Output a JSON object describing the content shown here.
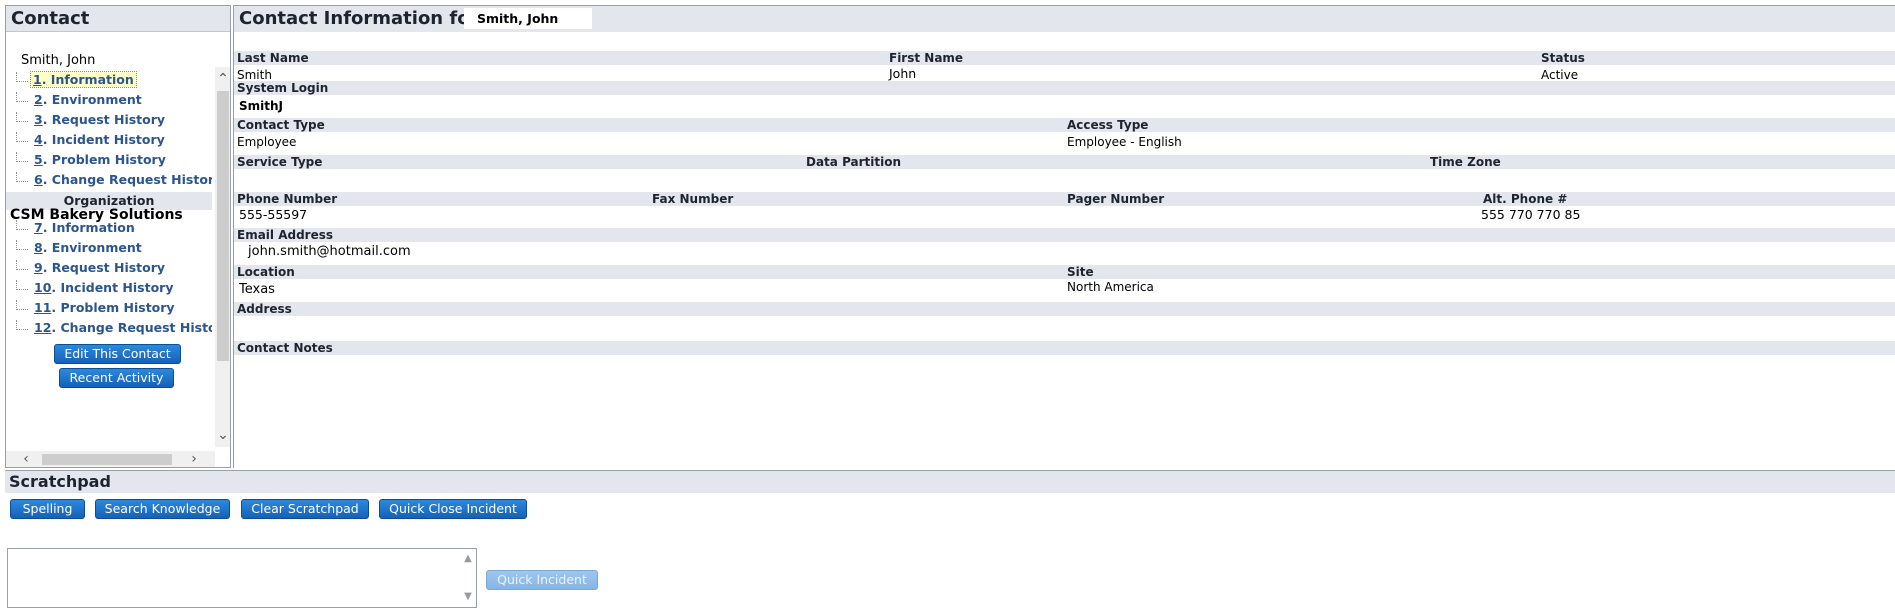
{
  "contact_panel": {
    "title": "Contact",
    "contact_name": "Smith, John",
    "contact_items": [
      {
        "num": "1",
        "label": ". Information"
      },
      {
        "num": "2",
        "label": ". Environment"
      },
      {
        "num": "3",
        "label": ". Request History"
      },
      {
        "num": "4",
        "label": ". Incident History"
      },
      {
        "num": "5",
        "label": ". Problem History"
      },
      {
        "num": "6",
        "label": ". Change Request History"
      }
    ],
    "organization_heading": "Organization",
    "organization_name": "CSM Bakery Solutions",
    "organization_items": [
      {
        "num": "7",
        "label": ". Information"
      },
      {
        "num": "8",
        "label": ". Environment"
      },
      {
        "num": "9",
        "label": ". Request History"
      },
      {
        "num": "10",
        "label": ". Incident History"
      },
      {
        "num": "11",
        "label": ". Problem History"
      },
      {
        "num": "12",
        "label": ". Change Request History"
      }
    ],
    "edit_button": "Edit This Contact",
    "recent_activity_button": "Recent Activity"
  },
  "contact_info": {
    "title": "Contact Information for",
    "title_name": "Smith, John",
    "last_name_label": "Last Name",
    "last_name": "Smith",
    "first_name_label": "First Name",
    "first_name": "John",
    "status_label": "Status",
    "status": "Active",
    "system_login_label": "System Login",
    "system_login": "SmithJ",
    "contact_type_label": "Contact Type",
    "contact_type": "Employee",
    "access_type_label": "Access Type",
    "access_type": "Employee - English",
    "service_type_label": "Service Type",
    "data_partition_label": "Data Partition",
    "time_zone_label": "Time Zone",
    "phone_label": "Phone Number",
    "phone": "555-55597",
    "fax_label": "Fax Number",
    "pager_label": "Pager Number",
    "alt_phone_label": "Alt. Phone #",
    "alt_phone": "555 770 770 85",
    "email_label": "Email Address",
    "email": "john.smith@hotmail.com",
    "location_label": "Location",
    "location": "Texas",
    "site_label": "Site",
    "site": "North America",
    "address_label": "Address",
    "contact_notes_label": "Contact Notes"
  },
  "scratchpad": {
    "title": "Scratchpad",
    "spelling_button": "Spelling",
    "search_knowledge_button": "Search Knowledge",
    "clear_button": "Clear Scratchpad",
    "quick_close_button": "Quick Close Incident",
    "quick_incident_button": "Quick Incident"
  },
  "icons": {
    "scroll_up": "chevron-up-icon",
    "scroll_down": "chevron-down-icon",
    "scroll_left": "chevron-left-icon",
    "scroll_right": "chevron-right-icon"
  },
  "colors": {
    "header_band": "#e3e6ec",
    "link_blue": "#2b5591",
    "button_blue": "#1462b8"
  }
}
